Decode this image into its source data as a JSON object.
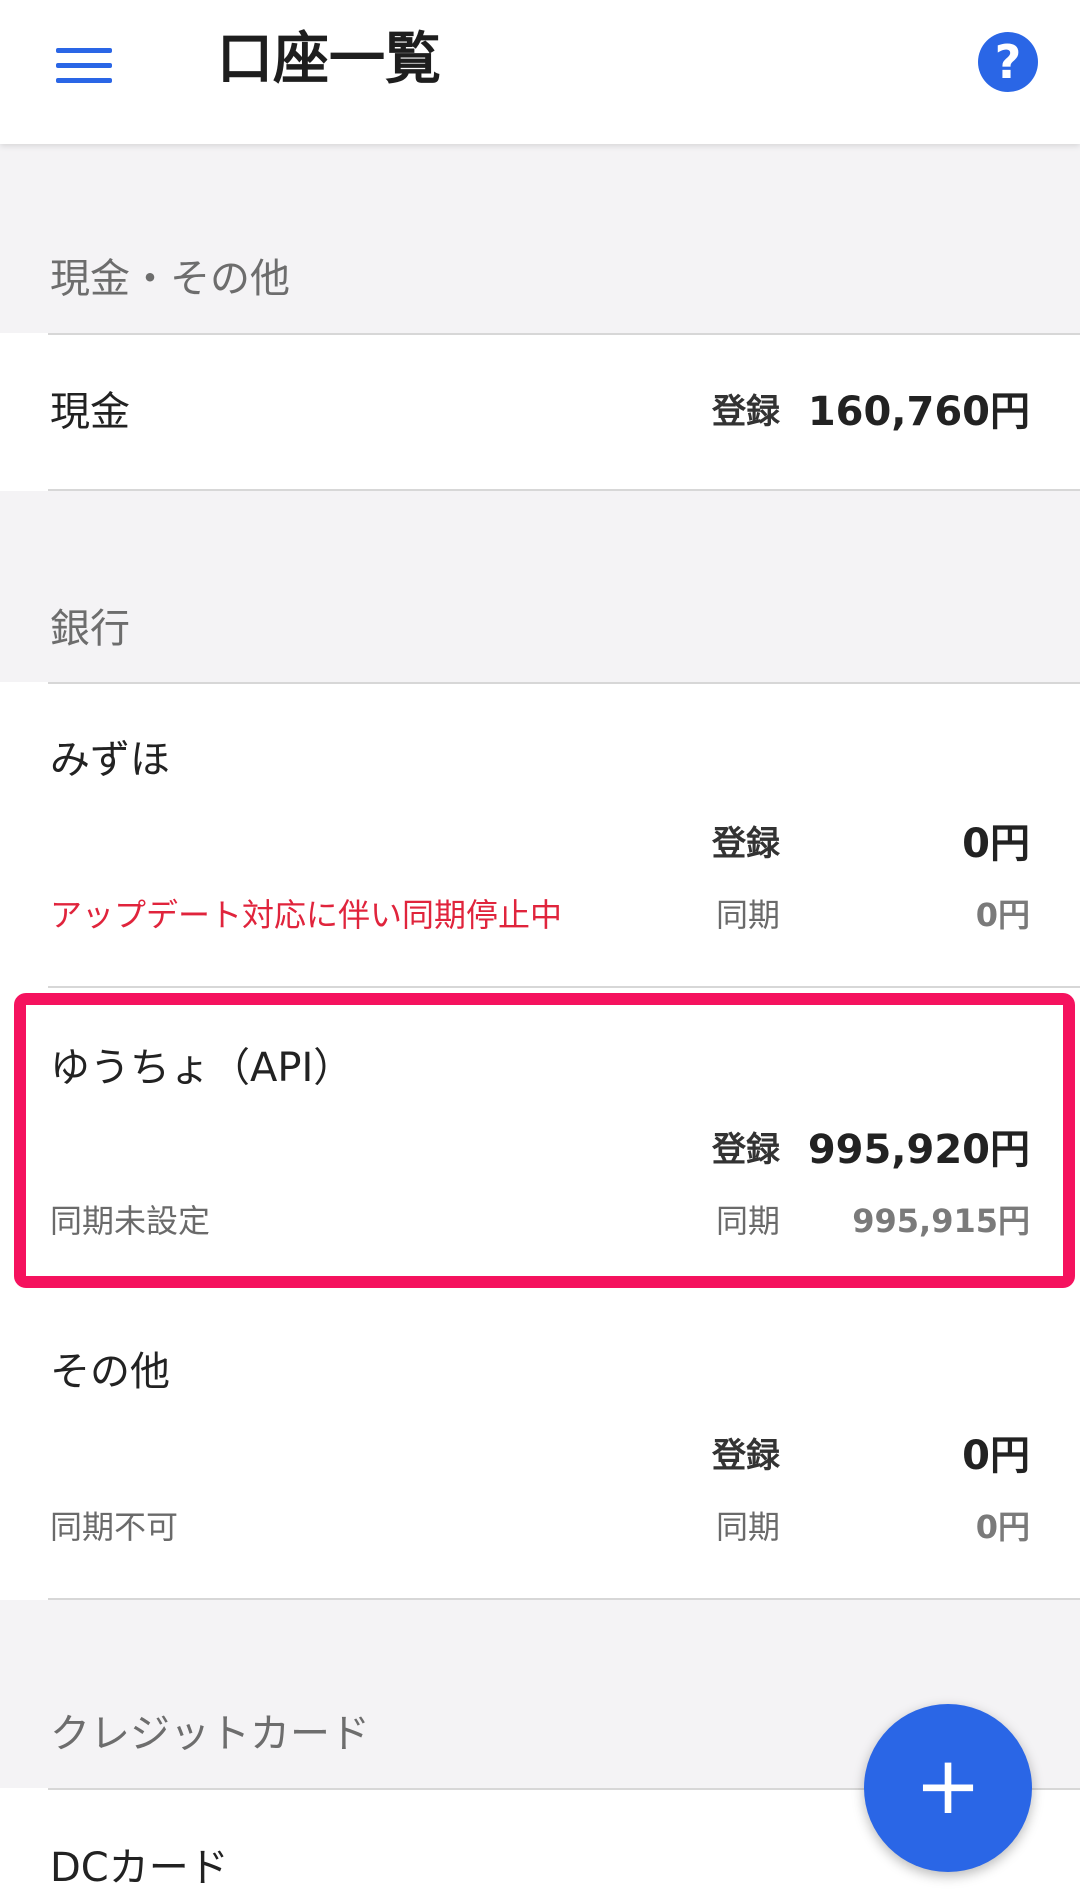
{
  "header": {
    "title": "口座一覧",
    "menu_icon": "hamburger-menu-icon",
    "help_icon": "help-circle-icon",
    "help_glyph": "?",
    "accent_color": "#2a66e6"
  },
  "sections": {
    "cash": {
      "header": "現金・その他",
      "accounts": [
        {
          "name": "現金",
          "registered_label": "登録",
          "registered_amount": "160,760円"
        }
      ]
    },
    "bank": {
      "header": "銀行",
      "accounts": [
        {
          "name": "みずほ",
          "registered_label": "登録",
          "registered_amount": "0円",
          "status": "アップデート対応に伴い同期停止中",
          "sync_label": "同期",
          "sync_amount": "0円"
        },
        {
          "name": "ゆうちょ（API）",
          "registered_label": "登録",
          "registered_amount": "995,920円",
          "status": "同期未設定",
          "sync_label": "同期",
          "sync_amount": "995,915円"
        },
        {
          "name": "その他",
          "registered_label": "登録",
          "registered_amount": "0円",
          "status": "同期不可",
          "sync_label": "同期",
          "sync_amount": "0円"
        }
      ]
    },
    "credit": {
      "header": "クレジットカード",
      "accounts": [
        {
          "name": "DCカード"
        }
      ]
    }
  },
  "fab": {
    "icon": "plus-icon",
    "glyph": "+"
  },
  "colors": {
    "warning": "#e0243c",
    "highlight": "#f5125e",
    "accent": "#2a66e6"
  }
}
